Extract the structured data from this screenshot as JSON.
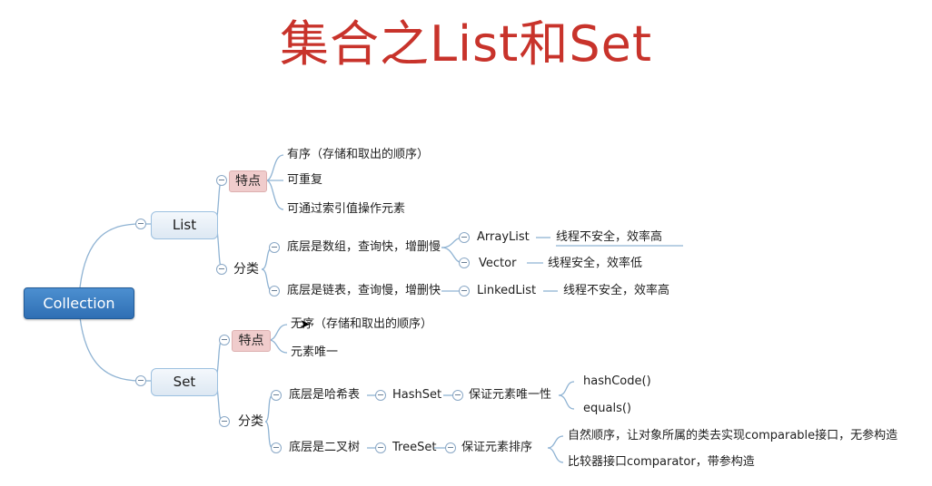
{
  "title": "集合之List和Set",
  "root": "Collection",
  "list": {
    "label": "List",
    "features": {
      "label": "特点",
      "items": [
        "有序（存储和取出的顺序）",
        "可重复",
        "可通过索引值操作元素"
      ]
    },
    "category": {
      "label": "分类",
      "array": {
        "label": "底层是数组，查询快，增删慢",
        "arraylist": "ArrayList",
        "arraylist_note": "线程不安全，效率高",
        "vector": "Vector",
        "vector_note": "线程安全，效率低"
      },
      "linked": {
        "label": "底层是链表，查询慢，增删快",
        "linkedlist": "LinkedList",
        "linkedlist_note": "线程不安全，效率高"
      }
    }
  },
  "set": {
    "label": "Set",
    "features": {
      "label": "特点",
      "items": [
        "无序（存储和取出的顺序）",
        "元素唯一"
      ]
    },
    "category": {
      "label": "分类",
      "hash": {
        "label": "底层是哈希表",
        "hashset": "HashSet",
        "guarantee": "保证元素唯一性",
        "methods": [
          "hashCode()",
          "equals()"
        ]
      },
      "tree": {
        "label": "底层是二叉树",
        "treeset": "TreeSet",
        "guarantee": "保证元素排序",
        "methods": [
          "自然顺序，让对象所属的类去实现comparable接口，无参构造",
          "比较器接口comparator，带参构造"
        ]
      }
    }
  }
}
